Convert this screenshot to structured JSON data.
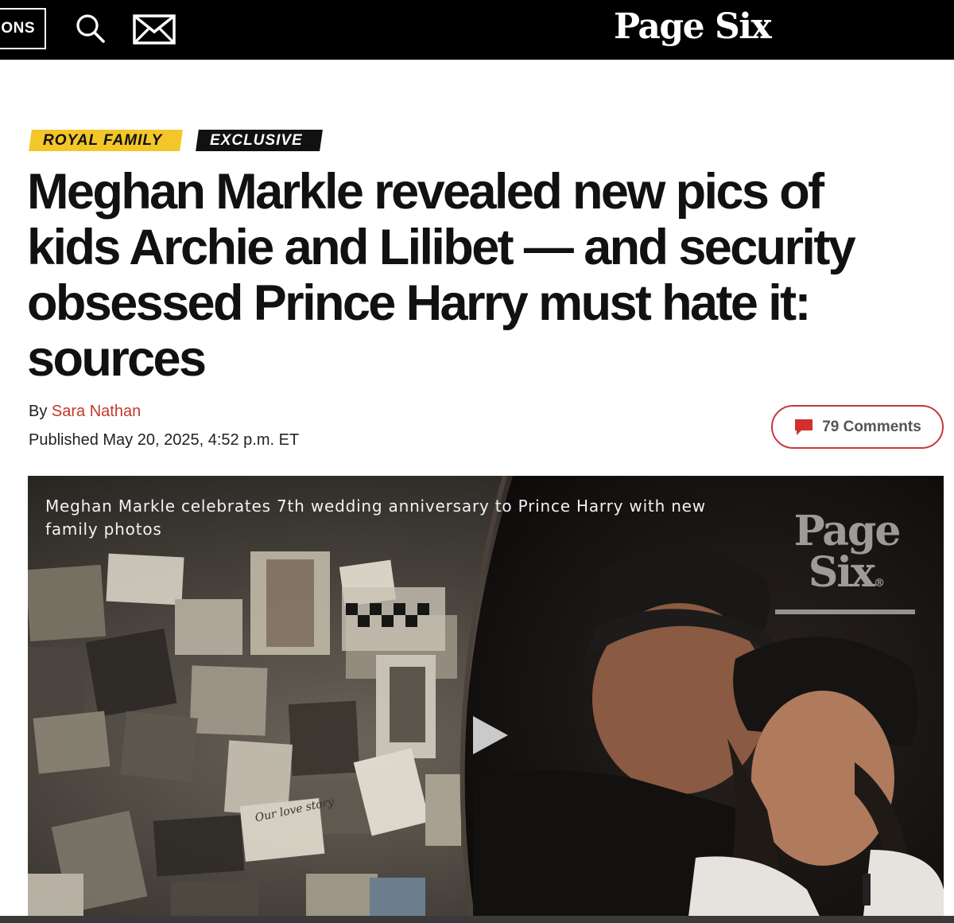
{
  "header": {
    "sections_label": "ONS",
    "logo_text": "Page Six",
    "icons": [
      "search-icon",
      "mail-icon"
    ]
  },
  "article": {
    "tags": [
      "ROYAL FAMILY",
      "EXCLUSIVE"
    ],
    "headline_lines": [
      "Meghan Markle revealed new pics of",
      "kids Archie and Lilibet — and security",
      "obsessed Prince Harry must hate it:",
      "sources"
    ],
    "byline_prefix": "By",
    "author": "Sara Nathan",
    "published": "Published May 20, 2025, 4:52 p.m. ET",
    "comments": "79 Comments"
  },
  "video": {
    "caption": "Meghan Markle celebrates 7th wedding anniversary to Prince Harry with new family photos",
    "watermark_line1": "Page",
    "watermark_line2": "Six",
    "watermark_reg": "®",
    "note_text": "Our love story",
    "colors": {
      "tag_yellow": "#f3c62a",
      "accent_red": "#c8383e",
      "author_red": "#c0392b"
    }
  }
}
